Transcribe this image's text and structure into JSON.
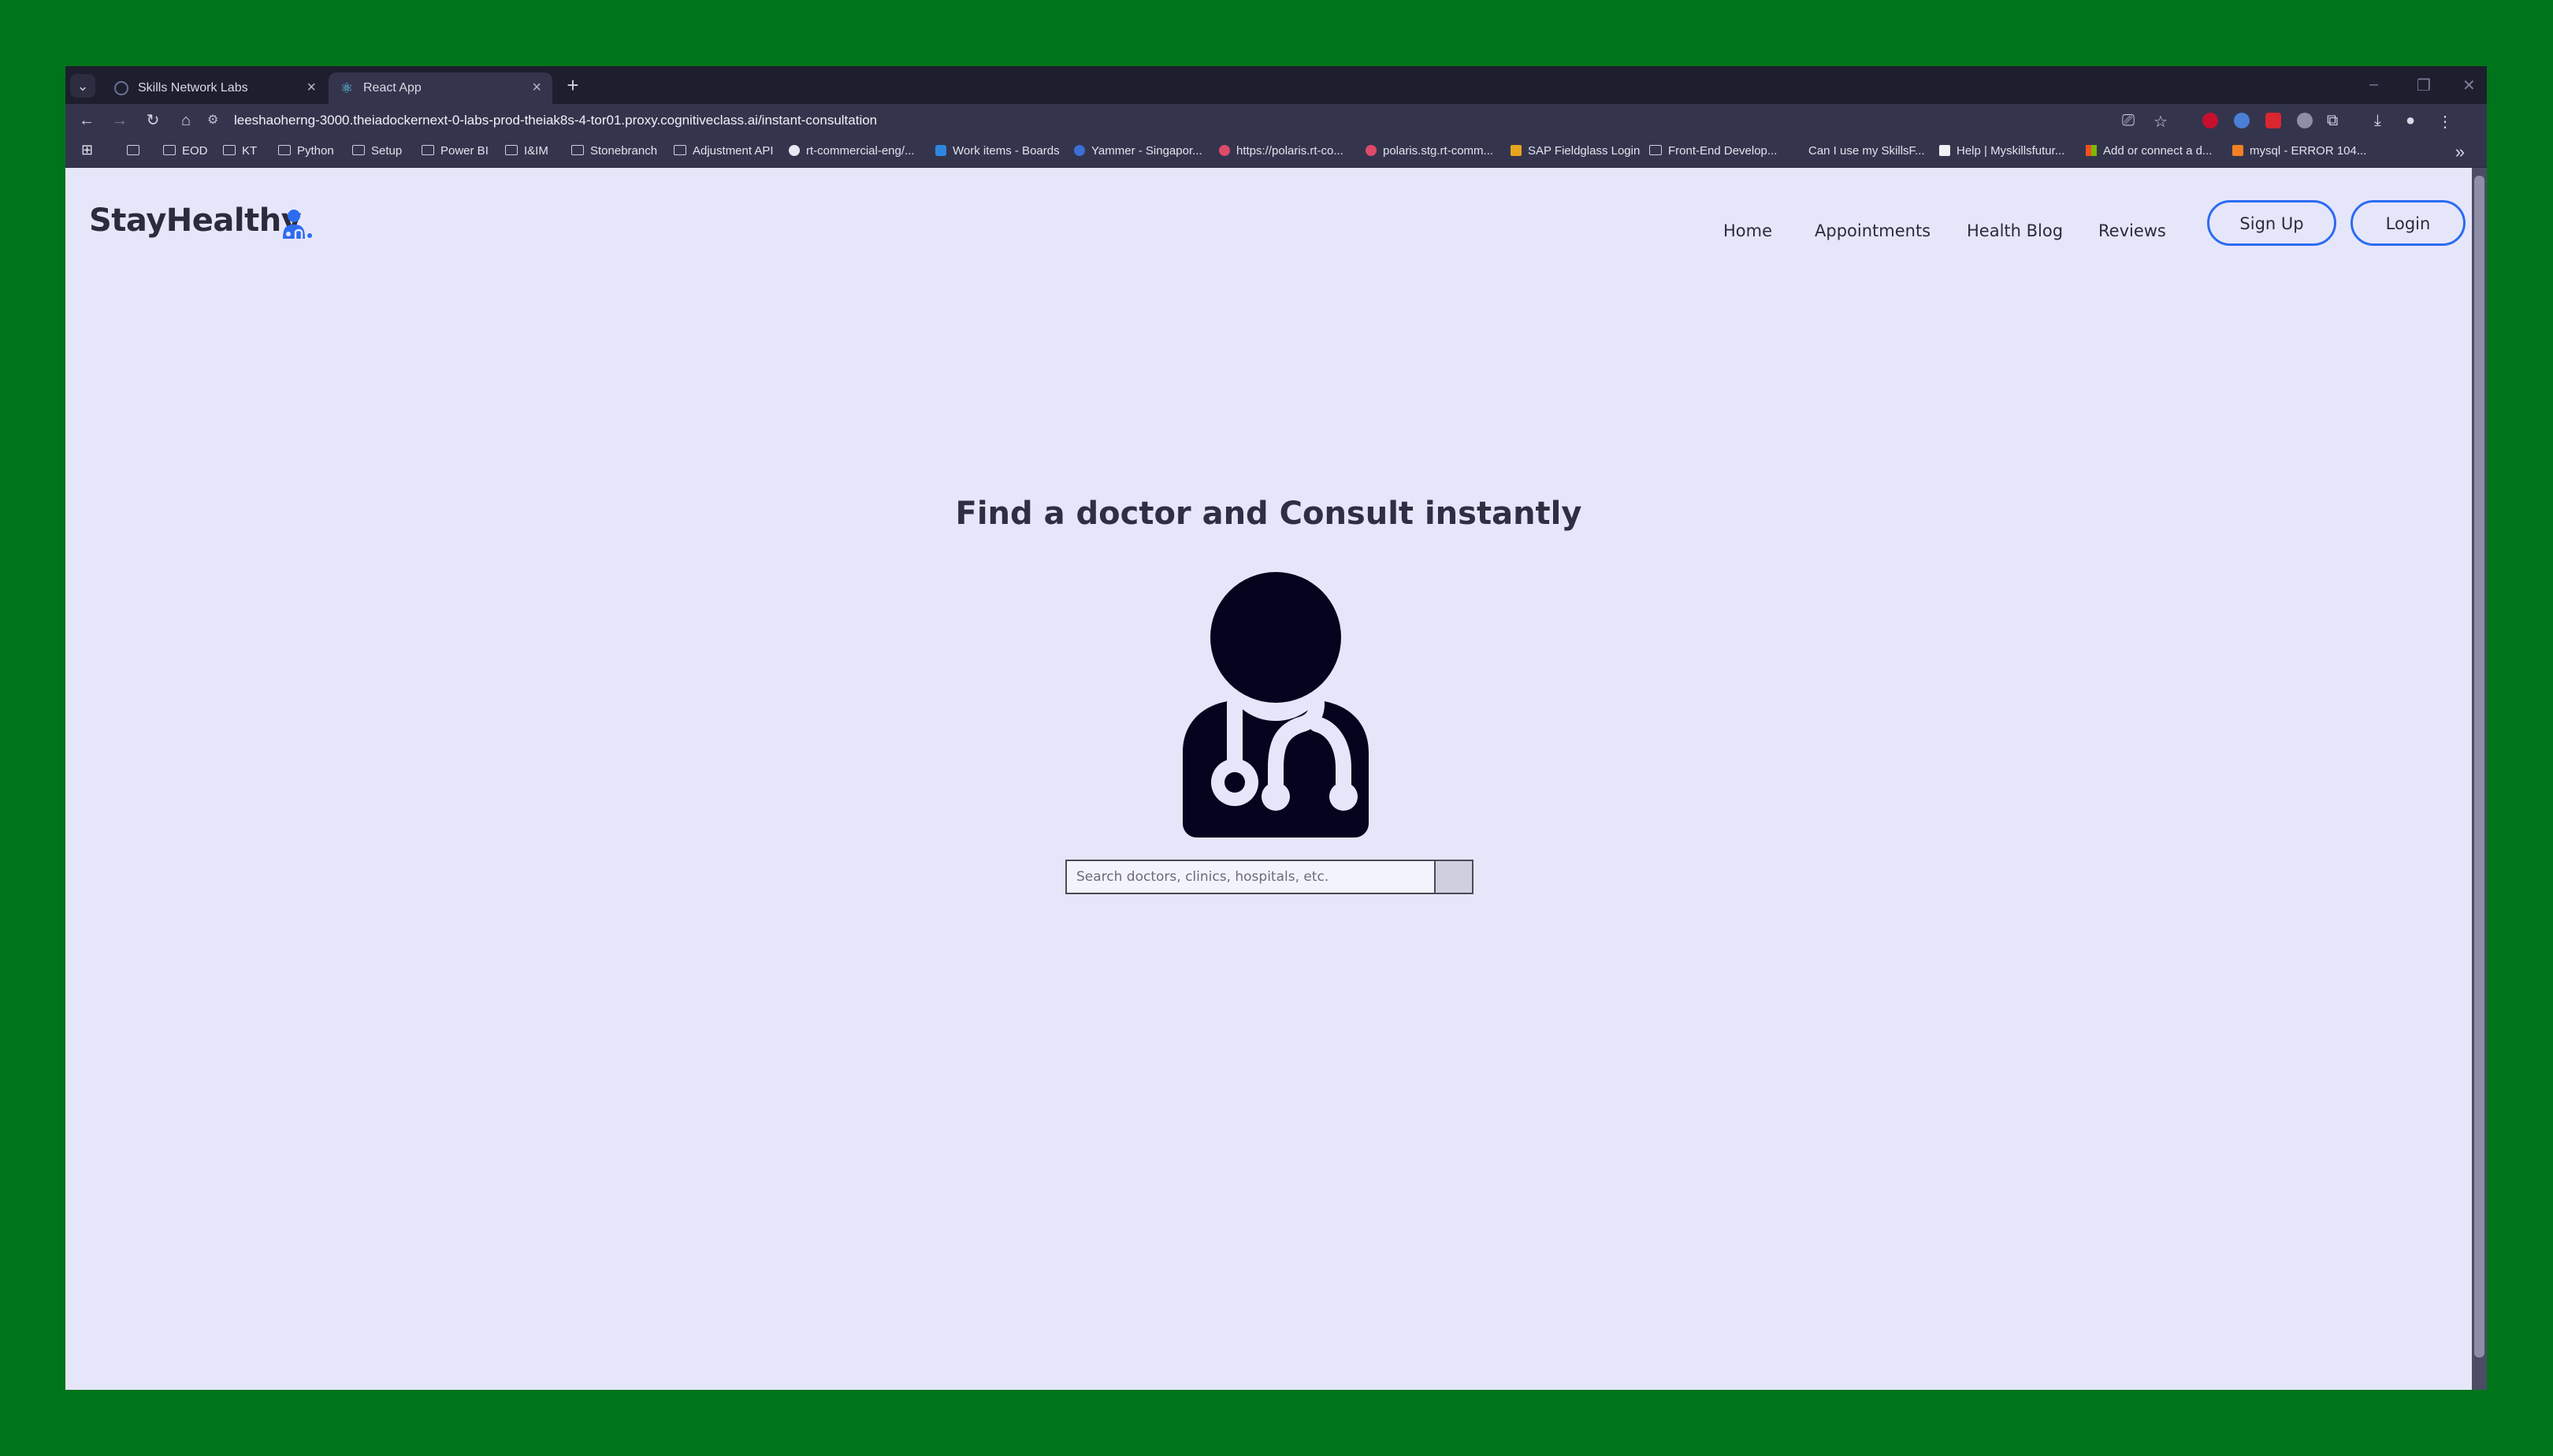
{
  "browser": {
    "tabs": [
      {
        "title": "Skills Network Labs"
      },
      {
        "title": "React App"
      }
    ],
    "new_tab_label": "+",
    "url": "leeshaoherng-3000.theiadockernext-0-labs-prod-theiak8s-4-tor01.proxy.cognitiveclass.ai/instant-consultation",
    "bookmarks": [
      {
        "label": "EOD",
        "icon": "folder-icon"
      },
      {
        "label": "KT",
        "icon": "folder-icon"
      },
      {
        "label": "Python",
        "icon": "folder-icon"
      },
      {
        "label": "Setup",
        "icon": "folder-icon"
      },
      {
        "label": "Power BI",
        "icon": "folder-icon"
      },
      {
        "label": "I&IM",
        "icon": "folder-icon"
      },
      {
        "label": "Stonebranch",
        "icon": "folder-icon"
      },
      {
        "label": "Adjustment API",
        "icon": "folder-icon"
      },
      {
        "label": "rt-commercial-eng/...",
        "icon": "github-icon"
      },
      {
        "label": "Work items - Boards",
        "icon": "azure-devops-icon"
      },
      {
        "label": "Yammer - Singapor...",
        "icon": "yammer-icon"
      },
      {
        "label": "https://polaris.rt-co...",
        "icon": "polaris-icon"
      },
      {
        "label": "polaris.stg.rt-comm...",
        "icon": "polaris-icon"
      },
      {
        "label": "SAP Fieldglass Login",
        "icon": "sap-icon"
      },
      {
        "label": "Front-End Develop...",
        "icon": "folder-icon"
      },
      {
        "label": "Can I use my SkillsF...",
        "icon": "page-icon"
      },
      {
        "label": "Help | Myskillsfutur...",
        "icon": "page-icon"
      },
      {
        "label": "Add or connect a d...",
        "icon": "microsoft-icon"
      },
      {
        "label": "mysql - ERROR 104...",
        "icon": "stackoverflow-icon"
      }
    ]
  },
  "app": {
    "brand": "StayHealthy",
    "nav": [
      "Home",
      "Appointments",
      "Health Blog",
      "Reviews"
    ],
    "signup_label": "Sign Up",
    "login_label": "Login",
    "hero_title": "Find a doctor and Consult instantly",
    "search_placeholder": "Search doctors, clinics, hospitals, etc."
  },
  "colors": {
    "desktop_bg": "#00741a",
    "page_bg": "#e6e6fb",
    "brand_blue": "#2b6cf0",
    "text_dark": "#2b2b3c",
    "icon_dark": "#04041e"
  }
}
